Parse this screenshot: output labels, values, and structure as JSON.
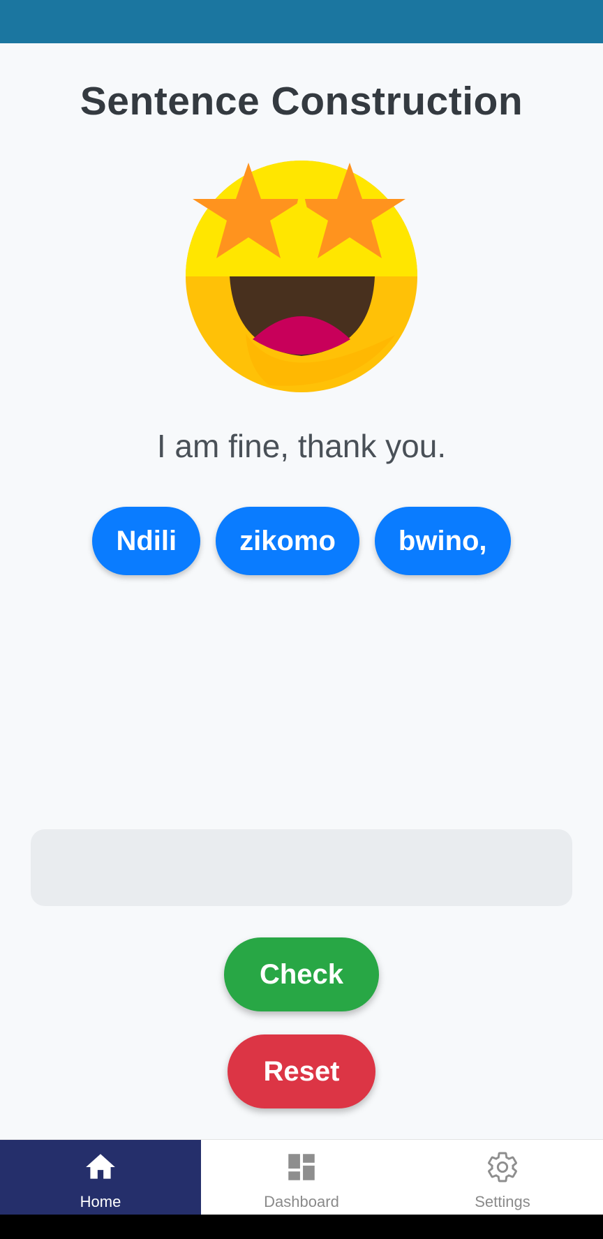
{
  "title": "Sentence Construction",
  "emoji": {
    "icon": "star-struck-face-icon"
  },
  "prompt": "I am fine, thank you.",
  "word_bank": [
    "Ndili",
    "zikomo",
    "bwino,"
  ],
  "answer": {
    "value": ""
  },
  "buttons": {
    "check": "Check",
    "reset": "Reset"
  },
  "nav": {
    "items": [
      {
        "label": "Home",
        "icon": "home-icon",
        "active": true
      },
      {
        "label": "Dashboard",
        "icon": "dashboard-icon",
        "active": false
      },
      {
        "label": "Settings",
        "icon": "settings-gear-icon",
        "active": false
      }
    ]
  },
  "colors": {
    "status_bar": "#1b76a0",
    "chip": "#0a7cff",
    "check": "#28a745",
    "reset": "#dc3545",
    "nav_active": "#252f6b"
  }
}
